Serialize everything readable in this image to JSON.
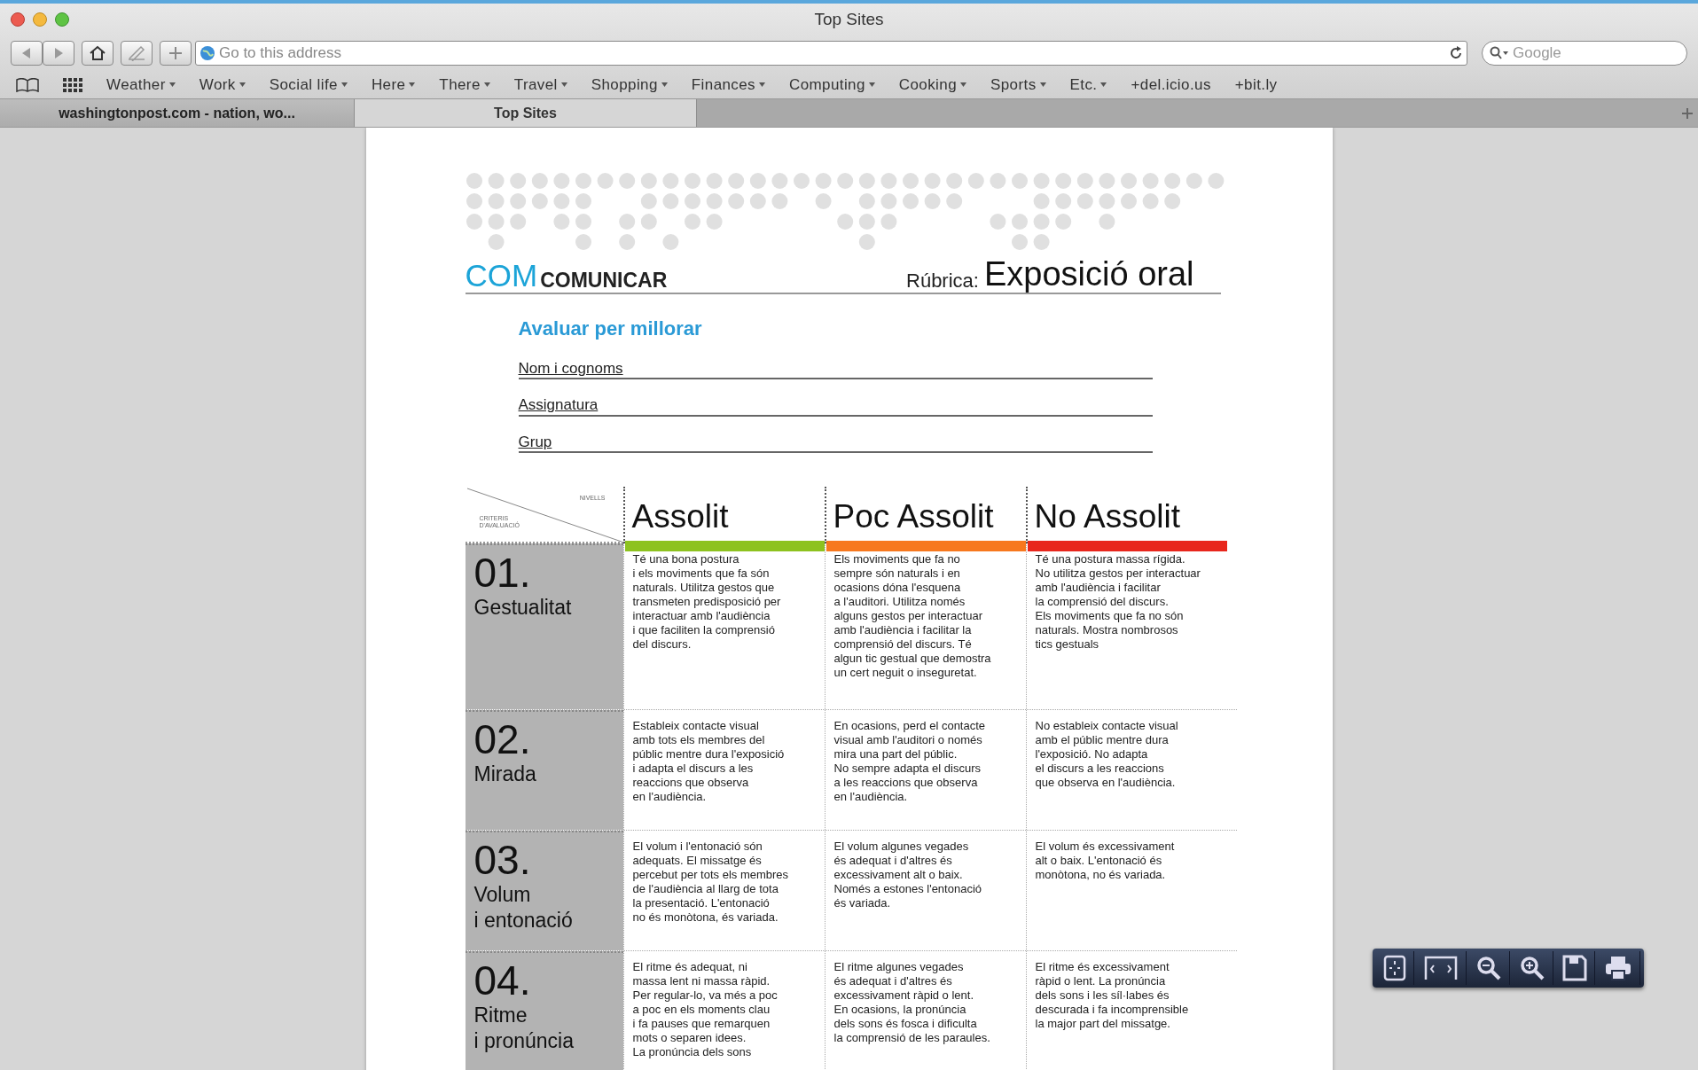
{
  "window": {
    "title": "Top Sites"
  },
  "toolbar": {
    "address_placeholder": "Go to this address",
    "search_placeholder": "Google"
  },
  "bookmarks": [
    {
      "label": "Weather",
      "kind": "menu"
    },
    {
      "label": "Work",
      "kind": "menu"
    },
    {
      "label": "Social life",
      "kind": "menu"
    },
    {
      "label": "Here",
      "kind": "menu"
    },
    {
      "label": "There",
      "kind": "menu"
    },
    {
      "label": "Travel",
      "kind": "menu"
    },
    {
      "label": "Shopping",
      "kind": "menu"
    },
    {
      "label": "Finances",
      "kind": "menu"
    },
    {
      "label": "Computing",
      "kind": "menu"
    },
    {
      "label": "Cooking",
      "kind": "menu"
    },
    {
      "label": "Sports",
      "kind": "menu"
    },
    {
      "label": "Etc.",
      "kind": "menu"
    },
    {
      "label": "+del.icio.us",
      "kind": "link"
    },
    {
      "label": "+bit.ly",
      "kind": "link"
    }
  ],
  "tabs": [
    {
      "label": "washingtonpost.com - nation, wo...",
      "selected": false
    },
    {
      "label": "Top Sites",
      "selected": true
    }
  ],
  "document": {
    "logo_accent": "COM",
    "logo_text": "COMUNICAR",
    "rubric_label": "Rúbrica:",
    "rubric_title": "Exposició oral",
    "subtitle": "Avaluar per millorar",
    "form_fields": [
      "Nom i cognoms",
      "Assignatura",
      "Grup"
    ],
    "table": {
      "corner_top": "NIVELLS",
      "corner_bottom": "CRITERIS D'AVALUACIÓ",
      "levels": [
        {
          "label": "Assolit",
          "color": "#8dc21f"
        },
        {
          "label": "Poc Assolit",
          "color": "#f7781e"
        },
        {
          "label": "No Assolit",
          "color": "#e8261c"
        }
      ],
      "rows": [
        {
          "number": "01.",
          "name": "Gestualitat",
          "cells": [
            "Té una bona postura\ni els moviments que fa són\nnaturals. Utilitza gestos que\ntransmeten predisposició per\ninteractuar amb l'audiència\ni que faciliten la comprensió\ndel discurs.",
            "Els moviments que fa no\nsempre són naturals i en\nocasions dóna l'esquena\na l'auditori. Utilitza només\nalguns gestos per interactuar\namb l'audiència i facilitar la\ncomprensió del discurs. Té\nalgun tic gestual que demostra\nun cert neguit o inseguretat.",
            "Té una postura massa rígida.\nNo utilitza gestos per interactuar\namb l'audiència i facilitar\nla comprensió del discurs.\nEls moviments que fa no són\nnaturals. Mostra nombrosos\ntics gestuals"
          ]
        },
        {
          "number": "02.",
          "name": "Mirada",
          "cells": [
            "Estableix contacte visual\namb tots els membres del\npúblic mentre dura l'exposició\ni adapta el discurs a les\nreaccions que observa\nen l'audiència.",
            "En ocasions, perd el contacte\nvisual amb l'auditori o només\nmira una part del públic.\nNo sempre adapta el discurs\na les reaccions que observa\nen l'audiència.",
            "No estableix contacte visual\namb el públic mentre dura\nl'exposició. No adapta\nel discurs a les reaccions\nque observa en l'audiència."
          ]
        },
        {
          "number": "03.",
          "name": "Volum\ni entonació",
          "cells": [
            "El volum i l'entonació són\nadequats. El missatge és\npercebut per tots els membres\nde l'audiència al llarg de tota\nla presentació. L'entonació\nno és monòtona, és variada.",
            "El volum algunes vegades\nés adequat i d'altres és\nexcessivament alt o baix.\nNomés a estones l'entonació\nés variada.",
            "El volum és excessivament\nalt o baix. L'entonació és\nmonòtona, no és variada."
          ]
        },
        {
          "number": "04.",
          "name": "Ritme\ni pronúncia",
          "cells": [
            "El ritme és adequat, ni\nmassa lent ni massa ràpid.\nPer regular-lo, va més a poc\na poc en els moments clau\ni  fa pauses que remarquen\nmots o separen idees.\nLa pronúncia dels sons",
            "El ritme algunes vegades\nés adequat i d'altres és\nexcessivament ràpid o lent.\nEn ocasions, la pronúncia\ndels sons és fosca i dificulta\nla comprensió de les paraules.",
            "El ritme és excessivament\nràpid o lent. La pronúncia\ndels sons i les síl·labes és\ndescurada i fa incomprensible\nla major part del missatge."
          ]
        }
      ]
    }
  }
}
